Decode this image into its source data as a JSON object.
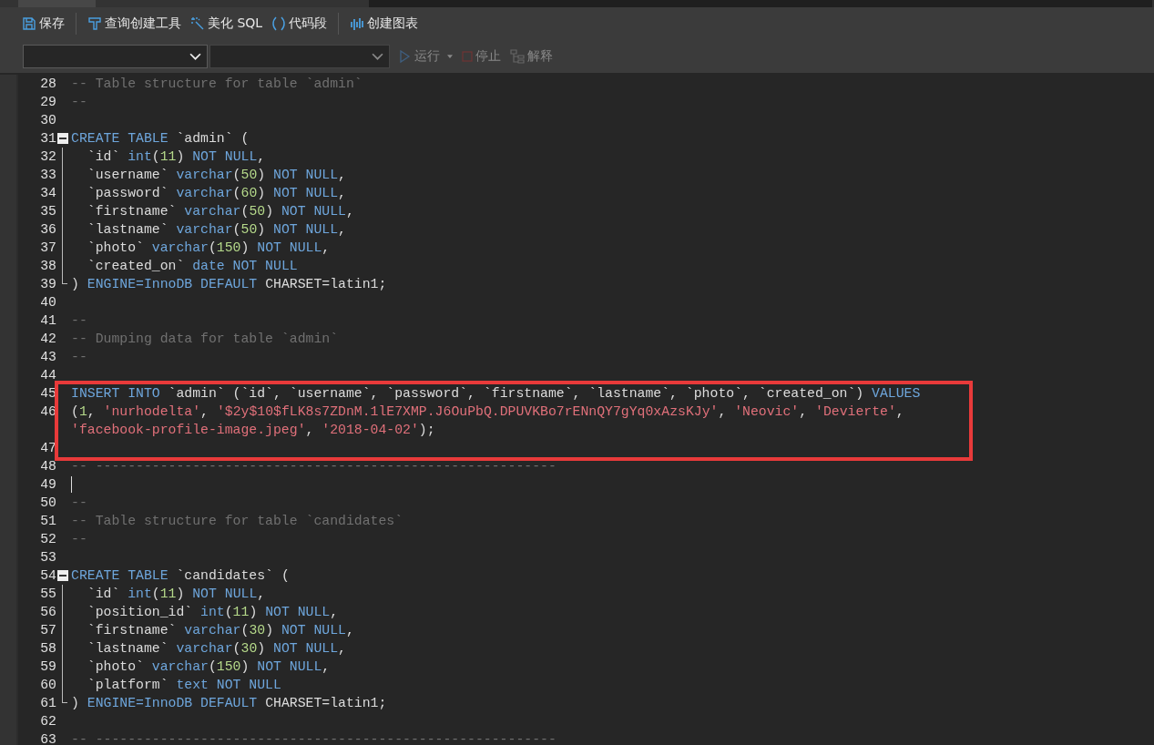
{
  "toolbar": [
    {
      "label": "保存",
      "kind": "save"
    },
    {
      "label": "查询创建工具",
      "kind": "builder"
    },
    {
      "label": "美化 SQL",
      "kind": "wand"
    },
    {
      "label": "代码段",
      "kind": "snippet"
    },
    {
      "label": "创建图表",
      "kind": "chart"
    }
  ],
  "query_bar": {
    "dropdowns": [
      {
        "disabled": false
      },
      {
        "disabled": true
      }
    ],
    "actions": [
      {
        "label": "运行",
        "kind": "run",
        "disabled": true,
        "caret": true
      },
      {
        "label": "停止",
        "kind": "stop",
        "disabled": true,
        "caret": false
      },
      {
        "label": "解释",
        "kind": "explain",
        "disabled": true,
        "caret": false
      }
    ]
  },
  "editor": {
    "lines": [
      {
        "number": "28",
        "tokens": [
          {
            "kind": "comment",
            "t": "-- Table structure for table `admin`"
          }
        ]
      },
      {
        "number": "29",
        "tokens": [
          {
            "kind": "comment",
            "t": "--"
          }
        ]
      },
      {
        "number": "30"
      },
      {
        "number": "31",
        "kind": "open",
        "tokens": [
          {
            "kind": "keyword",
            "t": "CREATE TABLE"
          },
          {
            "kind": "plain",
            "t": " `admin` ("
          }
        ]
      },
      {
        "number": "32",
        "kind": "inner",
        "tokens": [
          {
            "kind": "plain",
            "t": "  `id` "
          },
          {
            "kind": "keyword",
            "t": "int"
          },
          {
            "kind": "plain",
            "t": "("
          },
          {
            "kind": "number",
            "t": "11"
          },
          {
            "kind": "plain",
            "t": ") "
          },
          {
            "kind": "keyword",
            "t": "NOT NULL"
          },
          {
            "kind": "plain",
            "t": ","
          }
        ]
      },
      {
        "number": "33",
        "kind": "inner",
        "tokens": [
          {
            "kind": "plain",
            "t": "  `username` "
          },
          {
            "kind": "keyword",
            "t": "varchar"
          },
          {
            "kind": "plain",
            "t": "("
          },
          {
            "kind": "number",
            "t": "50"
          },
          {
            "kind": "plain",
            "t": ") "
          },
          {
            "kind": "keyword",
            "t": "NOT NULL"
          },
          {
            "kind": "plain",
            "t": ","
          }
        ]
      },
      {
        "number": "34",
        "kind": "inner",
        "tokens": [
          {
            "kind": "plain",
            "t": "  `password` "
          },
          {
            "kind": "keyword",
            "t": "varchar"
          },
          {
            "kind": "plain",
            "t": "("
          },
          {
            "kind": "number",
            "t": "60"
          },
          {
            "kind": "plain",
            "t": ") "
          },
          {
            "kind": "keyword",
            "t": "NOT NULL"
          },
          {
            "kind": "plain",
            "t": ","
          }
        ]
      },
      {
        "number": "35",
        "kind": "inner",
        "tokens": [
          {
            "kind": "plain",
            "t": "  `firstname` "
          },
          {
            "kind": "keyword",
            "t": "varchar"
          },
          {
            "kind": "plain",
            "t": "("
          },
          {
            "kind": "number",
            "t": "50"
          },
          {
            "kind": "plain",
            "t": ") "
          },
          {
            "kind": "keyword",
            "t": "NOT NULL"
          },
          {
            "kind": "plain",
            "t": ","
          }
        ]
      },
      {
        "number": "36",
        "kind": "inner",
        "tokens": [
          {
            "kind": "plain",
            "t": "  `lastname` "
          },
          {
            "kind": "keyword",
            "t": "varchar"
          },
          {
            "kind": "plain",
            "t": "("
          },
          {
            "kind": "number",
            "t": "50"
          },
          {
            "kind": "plain",
            "t": ") "
          },
          {
            "kind": "keyword",
            "t": "NOT NULL"
          },
          {
            "kind": "plain",
            "t": ","
          }
        ]
      },
      {
        "number": "37",
        "kind": "inner",
        "tokens": [
          {
            "kind": "plain",
            "t": "  `photo` "
          },
          {
            "kind": "keyword",
            "t": "varchar"
          },
          {
            "kind": "plain",
            "t": "("
          },
          {
            "kind": "number",
            "t": "150"
          },
          {
            "kind": "plain",
            "t": ") "
          },
          {
            "kind": "keyword",
            "t": "NOT NULL"
          },
          {
            "kind": "plain",
            "t": ","
          }
        ]
      },
      {
        "number": "38",
        "kind": "inner",
        "tokens": [
          {
            "kind": "plain",
            "t": "  `created_on` "
          },
          {
            "kind": "keyword",
            "t": "date NOT NULL"
          }
        ]
      },
      {
        "number": "39",
        "kind": "close",
        "tokens": [
          {
            "kind": "plain",
            "t": ") "
          },
          {
            "kind": "keyword",
            "t": "ENGINE=InnoDB DEFAULT"
          },
          {
            "kind": "plain",
            "t": " CHARSET=latin1;"
          }
        ]
      },
      {
        "number": "40"
      },
      {
        "number": "41",
        "tokens": [
          {
            "kind": "comment",
            "t": "--"
          }
        ]
      },
      {
        "number": "42",
        "tokens": [
          {
            "kind": "comment",
            "t": "-- Dumping data for table `admin`"
          }
        ]
      },
      {
        "number": "43",
        "tokens": [
          {
            "kind": "comment",
            "t": "--"
          }
        ]
      },
      {
        "number": "44"
      },
      {
        "number": "45",
        "highlighted": true,
        "tokens": [
          {
            "kind": "keyword",
            "t": "INSERT INTO"
          },
          {
            "kind": "plain",
            "t": " `admin` (`id`, `username`, `password`, `firstname`, `lastname`, `photo`, `created_on`) "
          },
          {
            "kind": "keyword",
            "t": "VALUES"
          }
        ]
      },
      {
        "number": "46",
        "highlighted": true,
        "tokens": [
          {
            "kind": "plain",
            "t": "("
          },
          {
            "kind": "number",
            "t": "1"
          },
          {
            "kind": "plain",
            "t": ", "
          },
          {
            "kind": "string",
            "t": "'nurhodelta'"
          },
          {
            "kind": "plain",
            "t": ", "
          },
          {
            "kind": "string",
            "t": "'$2y$10$fLK8s7ZDnM.1lE7XMP.J6OuPbQ.DPUVKBo7rENnQY7gYq0xAzsKJy'"
          },
          {
            "kind": "plain",
            "t": ", "
          },
          {
            "kind": "string",
            "t": "'Neovic'"
          },
          {
            "kind": "plain",
            "t": ", "
          },
          {
            "kind": "string",
            "t": "'Devierte'"
          },
          {
            "kind": "plain",
            "t": ","
          },
          {
            "kind": "break"
          },
          {
            "kind": "string",
            "t": "'facebook-profile-image.jpeg'"
          },
          {
            "kind": "plain",
            "t": ", "
          },
          {
            "kind": "string",
            "t": "'2018-04-02'"
          },
          {
            "kind": "plain",
            "t": ");"
          }
        ]
      },
      {
        "number": "47",
        "highlighted": true
      },
      {
        "number": "48",
        "tokens": [
          {
            "kind": "comment",
            "t": "-- ---------------------------------------------------------"
          }
        ]
      },
      {
        "number": "49",
        "cursor": true
      },
      {
        "number": "50",
        "tokens": [
          {
            "kind": "comment",
            "t": "--"
          }
        ]
      },
      {
        "number": "51",
        "tokens": [
          {
            "kind": "comment",
            "t": "-- Table structure for table `candidates`"
          }
        ]
      },
      {
        "number": "52",
        "tokens": [
          {
            "kind": "comment",
            "t": "--"
          }
        ]
      },
      {
        "number": "53"
      },
      {
        "number": "54",
        "kind": "open",
        "tokens": [
          {
            "kind": "keyword",
            "t": "CREATE TABLE"
          },
          {
            "kind": "plain",
            "t": " `candidates` ("
          }
        ]
      },
      {
        "number": "55",
        "kind": "inner",
        "tokens": [
          {
            "kind": "plain",
            "t": "  `id` "
          },
          {
            "kind": "keyword",
            "t": "int"
          },
          {
            "kind": "plain",
            "t": "("
          },
          {
            "kind": "number",
            "t": "11"
          },
          {
            "kind": "plain",
            "t": ") "
          },
          {
            "kind": "keyword",
            "t": "NOT NULL"
          },
          {
            "kind": "plain",
            "t": ","
          }
        ]
      },
      {
        "number": "56",
        "kind": "inner",
        "tokens": [
          {
            "kind": "plain",
            "t": "  `position_id` "
          },
          {
            "kind": "keyword",
            "t": "int"
          },
          {
            "kind": "plain",
            "t": "("
          },
          {
            "kind": "number",
            "t": "11"
          },
          {
            "kind": "plain",
            "t": ") "
          },
          {
            "kind": "keyword",
            "t": "NOT NULL"
          },
          {
            "kind": "plain",
            "t": ","
          }
        ]
      },
      {
        "number": "57",
        "kind": "inner",
        "tokens": [
          {
            "kind": "plain",
            "t": "  `firstname` "
          },
          {
            "kind": "keyword",
            "t": "varchar"
          },
          {
            "kind": "plain",
            "t": "("
          },
          {
            "kind": "number",
            "t": "30"
          },
          {
            "kind": "plain",
            "t": ") "
          },
          {
            "kind": "keyword",
            "t": "NOT NULL"
          },
          {
            "kind": "plain",
            "t": ","
          }
        ]
      },
      {
        "number": "58",
        "kind": "inner",
        "tokens": [
          {
            "kind": "plain",
            "t": "  `lastname` "
          },
          {
            "kind": "keyword",
            "t": "varchar"
          },
          {
            "kind": "plain",
            "t": "("
          },
          {
            "kind": "number",
            "t": "30"
          },
          {
            "kind": "plain",
            "t": ") "
          },
          {
            "kind": "keyword",
            "t": "NOT NULL"
          },
          {
            "kind": "plain",
            "t": ","
          }
        ]
      },
      {
        "number": "59",
        "kind": "inner",
        "tokens": [
          {
            "kind": "plain",
            "t": "  `photo` "
          },
          {
            "kind": "keyword",
            "t": "varchar"
          },
          {
            "kind": "plain",
            "t": "("
          },
          {
            "kind": "number",
            "t": "150"
          },
          {
            "kind": "plain",
            "t": ") "
          },
          {
            "kind": "keyword",
            "t": "NOT NULL"
          },
          {
            "kind": "plain",
            "t": ","
          }
        ]
      },
      {
        "number": "60",
        "kind": "inner",
        "tokens": [
          {
            "kind": "plain",
            "t": "  `platform` "
          },
          {
            "kind": "keyword",
            "t": "text NOT NULL"
          }
        ]
      },
      {
        "number": "61",
        "kind": "close",
        "tokens": [
          {
            "kind": "plain",
            "t": ") "
          },
          {
            "kind": "keyword",
            "t": "ENGINE=InnoDB DEFAULT"
          },
          {
            "kind": "plain",
            "t": " CHARSET=latin1;"
          }
        ]
      },
      {
        "number": "62"
      },
      {
        "number": "63",
        "tokens": [
          {
            "kind": "comment",
            "t": "-- ---------------------------------------------------------"
          }
        ]
      }
    ]
  }
}
